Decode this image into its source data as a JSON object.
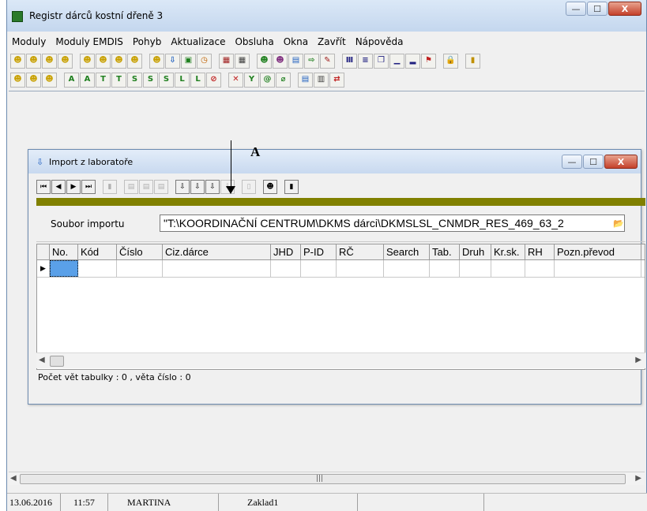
{
  "app": {
    "title": "Registr dárců kostní dřeně 3",
    "caption_buttons": {
      "minimize": "—",
      "maximize": "☐",
      "close": "X"
    }
  },
  "menu": [
    "Moduly",
    "Moduly EMDIS",
    "Pohyb",
    "Aktualizace",
    "Obsluha",
    "Okna",
    "Zavřít",
    "Nápověda"
  ],
  "toolbar": {
    "row1": [
      {
        "icon": "person-icon",
        "glyph": "☻",
        "color": "#c8a000"
      },
      {
        "icon": "person-icon",
        "glyph": "☻",
        "color": "#c8a000"
      },
      {
        "icon": "person-icon",
        "glyph": "☻",
        "color": "#c8a000"
      },
      {
        "icon": "person-icon",
        "glyph": "☻",
        "color": "#c8a000"
      },
      {
        "sep": true
      },
      {
        "icon": "person-icon",
        "glyph": "☻",
        "color": "#c8a000"
      },
      {
        "icon": "person-icon",
        "glyph": "☻",
        "color": "#c8a000"
      },
      {
        "icon": "person-icon",
        "glyph": "☻",
        "color": "#c8a000"
      },
      {
        "icon": "person-icon",
        "glyph": "☻",
        "color": "#c8a000"
      },
      {
        "sep": true
      },
      {
        "icon": "person-icon",
        "glyph": "☻",
        "color": "#c8a000"
      },
      {
        "icon": "import-icon",
        "glyph": "⇩",
        "color": "#2060c0"
      },
      {
        "icon": "monitor-icon",
        "glyph": "▣",
        "color": "#208020"
      },
      {
        "icon": "clock-icon",
        "glyph": "◷",
        "color": "#c06000"
      },
      {
        "sep": true
      },
      {
        "icon": "calendar-icon",
        "glyph": "▦",
        "color": "#a02020"
      },
      {
        "icon": "table-icon",
        "glyph": "▦",
        "color": "#404040"
      },
      {
        "sep": true
      },
      {
        "icon": "person-icon",
        "glyph": "☻",
        "color": "#208020"
      },
      {
        "icon": "person-icon",
        "glyph": "☻",
        "color": "#803080"
      },
      {
        "icon": "monitor-icon",
        "glyph": "▤",
        "color": "#2060c0"
      },
      {
        "icon": "forward-icon",
        "glyph": "⇨",
        "color": "#208020"
      },
      {
        "icon": "pen-icon",
        "glyph": "✎",
        "color": "#a02020"
      },
      {
        "sep": true
      },
      {
        "icon": "columns-icon",
        "glyph": "Ⅲ",
        "color": "#202080"
      },
      {
        "icon": "rows-icon",
        "glyph": "≡",
        "color": "#202080"
      },
      {
        "icon": "pages-icon",
        "glyph": "❐",
        "color": "#202080"
      },
      {
        "icon": "chart-icon",
        "glyph": "▁",
        "color": "#202080"
      },
      {
        "icon": "chart-icon",
        "glyph": "▂",
        "color": "#202080"
      },
      {
        "icon": "flag-icon",
        "glyph": "⚑",
        "color": "#c02020"
      },
      {
        "sep": true
      },
      {
        "icon": "lock-icon",
        "glyph": "🔒",
        "color": "#404040"
      },
      {
        "sep": true
      },
      {
        "icon": "exit-door-icon",
        "glyph": "▮",
        "color": "#c09000"
      }
    ],
    "row2": [
      {
        "icon": "person-icon",
        "glyph": "☻",
        "color": "#c8a000"
      },
      {
        "icon": "person-icon",
        "glyph": "☻",
        "color": "#c8a000"
      },
      {
        "icon": "person-icon",
        "glyph": "☻",
        "color": "#c8a000"
      },
      {
        "sep": true
      },
      {
        "icon": "letter-a-icon",
        "glyph": "A",
        "color": "#208020"
      },
      {
        "icon": "letter-a-icon",
        "glyph": "A",
        "color": "#208020"
      },
      {
        "icon": "letter-t-icon",
        "glyph": "T",
        "color": "#208020"
      },
      {
        "icon": "letter-t-icon",
        "glyph": "T",
        "color": "#208020"
      },
      {
        "icon": "letter-s-icon",
        "glyph": "S",
        "color": "#208020"
      },
      {
        "icon": "letter-s-icon",
        "glyph": "S",
        "color": "#208020"
      },
      {
        "icon": "letter-s-icon",
        "glyph": "S",
        "color": "#208020"
      },
      {
        "icon": "letter-l-icon",
        "glyph": "L",
        "color": "#208020"
      },
      {
        "icon": "letter-l-icon",
        "glyph": "L",
        "color": "#208020"
      },
      {
        "icon": "no-entry-icon",
        "glyph": "⊘",
        "color": "#c02020"
      },
      {
        "sep": true
      },
      {
        "icon": "delete-icon",
        "glyph": "✕",
        "color": "#c02020"
      },
      {
        "icon": "letter-y-icon",
        "glyph": "Y",
        "color": "#208020"
      },
      {
        "icon": "at-icon",
        "glyph": "@",
        "color": "#208020"
      },
      {
        "icon": "crossed-icon",
        "glyph": "⌀",
        "color": "#208020"
      },
      {
        "sep": true
      },
      {
        "icon": "monitor-icon",
        "glyph": "▤",
        "color": "#2060c0"
      },
      {
        "icon": "document-icon",
        "glyph": "▥",
        "color": "#404040"
      },
      {
        "icon": "swap-icon",
        "glyph": "⇄",
        "color": "#c02020"
      }
    ]
  },
  "child_window": {
    "title": "Import z laboratoře",
    "icon_glyph": "⇩",
    "toolbar": [
      {
        "icon": "first-record-icon",
        "glyph": "⏮",
        "disabled": false
      },
      {
        "icon": "prev-record-icon",
        "glyph": "◀",
        "disabled": false
      },
      {
        "icon": "next-record-icon",
        "glyph": "▶",
        "disabled": false
      },
      {
        "icon": "last-record-icon",
        "glyph": "⏭",
        "disabled": false
      },
      {
        "sep": true
      },
      {
        "icon": "delete-record-icon",
        "glyph": "▮",
        "disabled": true
      },
      {
        "sep": true
      },
      {
        "icon": "copy-icon",
        "glyph": "▤",
        "disabled": true
      },
      {
        "icon": "copy-icon",
        "glyph": "▤",
        "disabled": true
      },
      {
        "icon": "copy-icon",
        "glyph": "▤",
        "disabled": true
      },
      {
        "sep": true
      },
      {
        "icon": "import-icon",
        "glyph": "⇩",
        "disabled": false
      },
      {
        "icon": "import-icon",
        "glyph": "⇩",
        "disabled": false
      },
      {
        "icon": "import-icon",
        "glyph": "⇩",
        "disabled": false
      },
      {
        "icon": "import-icon",
        "glyph": "⇩",
        "disabled": true
      },
      {
        "sep": true
      },
      {
        "icon": "page-icon",
        "glyph": "▯",
        "disabled": true
      },
      {
        "sep": true
      },
      {
        "icon": "person-icon",
        "glyph": "☻",
        "disabled": false
      },
      {
        "sep": true
      },
      {
        "icon": "exit-door-icon",
        "glyph": "▮",
        "disabled": false
      }
    ],
    "file_label": "Soubor importu",
    "file_value": "\"T:\\KOORDINAČNÍ CENTRUM\\DKMS dárci\\DKMSLSL_CNMDR_RES_469_63_2",
    "grid_columns": [
      "No.",
      "Kód",
      "Číslo",
      "Ciz.dárce",
      "JHD",
      "P-ID",
      "RČ",
      "Search",
      "Tab.",
      "Druh",
      "Kr.sk.",
      "RH",
      "Pozn.převod"
    ],
    "status_text": "Počet vět tabulky : 0 , věta číslo : 0"
  },
  "annotation": {
    "label": "A"
  },
  "status_bar": {
    "date": "13.06.2016",
    "time": "11:57",
    "user": "MARTINA",
    "db": "Zaklad1"
  },
  "colors": {
    "accent_strip": "#808000",
    "active_cell": "#5aa0e8"
  }
}
